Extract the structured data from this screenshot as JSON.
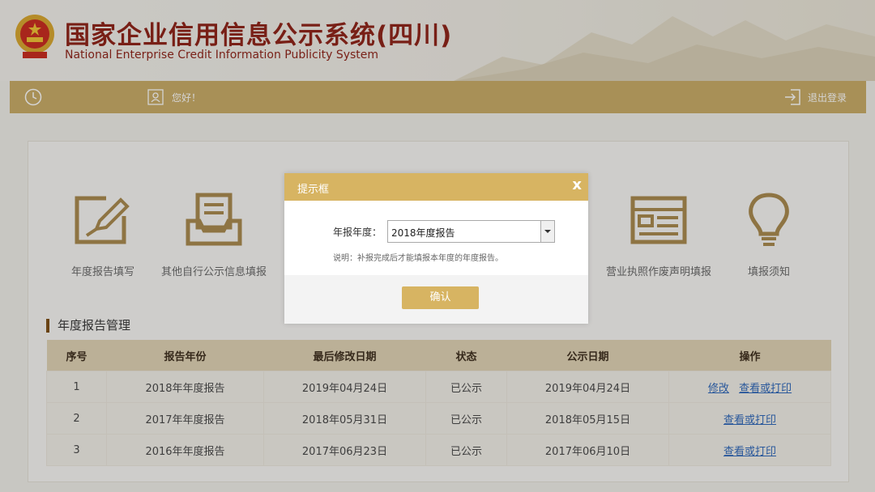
{
  "header": {
    "title_cn": "国家企业信用信息公示系统(四川)",
    "title_en": "National Enterprise Credit Information Publicity System"
  },
  "navbar": {
    "greeting": "您好！",
    "logout": "退出登录"
  },
  "functions": [
    {
      "label": "年度报告填写",
      "icon": "pencil-edit-icon"
    },
    {
      "label": "其他自行公示信息填报",
      "icon": "document-tray-icon"
    },
    {
      "label": "营业执照作废声明填报",
      "icon": "browser-window-icon"
    },
    {
      "label": "填报须知",
      "icon": "lightbulb-icon"
    }
  ],
  "annual_reports": {
    "section_title": "年度报告管理",
    "columns": [
      "序号",
      "报告年份",
      "最后修改日期",
      "状态",
      "公示日期",
      "操作"
    ],
    "rows": [
      {
        "no": "1",
        "year": "2018年年度报告",
        "modified": "2019年04月24日",
        "status": "已公示",
        "published": "2019年04月24日",
        "actions": [
          "修改",
          "查看或打印"
        ]
      },
      {
        "no": "2",
        "year": "2017年年度报告",
        "modified": "2018年05月31日",
        "status": "已公示",
        "published": "2018年05月15日",
        "actions": [
          "查看或打印"
        ]
      },
      {
        "no": "3",
        "year": "2016年年度报告",
        "modified": "2017年06月23日",
        "status": "已公示",
        "published": "2017年06月10日",
        "actions": [
          "查看或打印"
        ]
      }
    ]
  },
  "modal": {
    "title": "提示框",
    "close": "x",
    "field_label": "年报年度：",
    "selected": "2018年度报告",
    "note": "说明：补报完成后才能填报本年度的年度报告。",
    "confirm": "确认"
  },
  "colors": {
    "brand_red": "#8d1d12",
    "gold": "#c9aa63",
    "modal_gold": "#d7b462",
    "link": "#2a64b8"
  }
}
